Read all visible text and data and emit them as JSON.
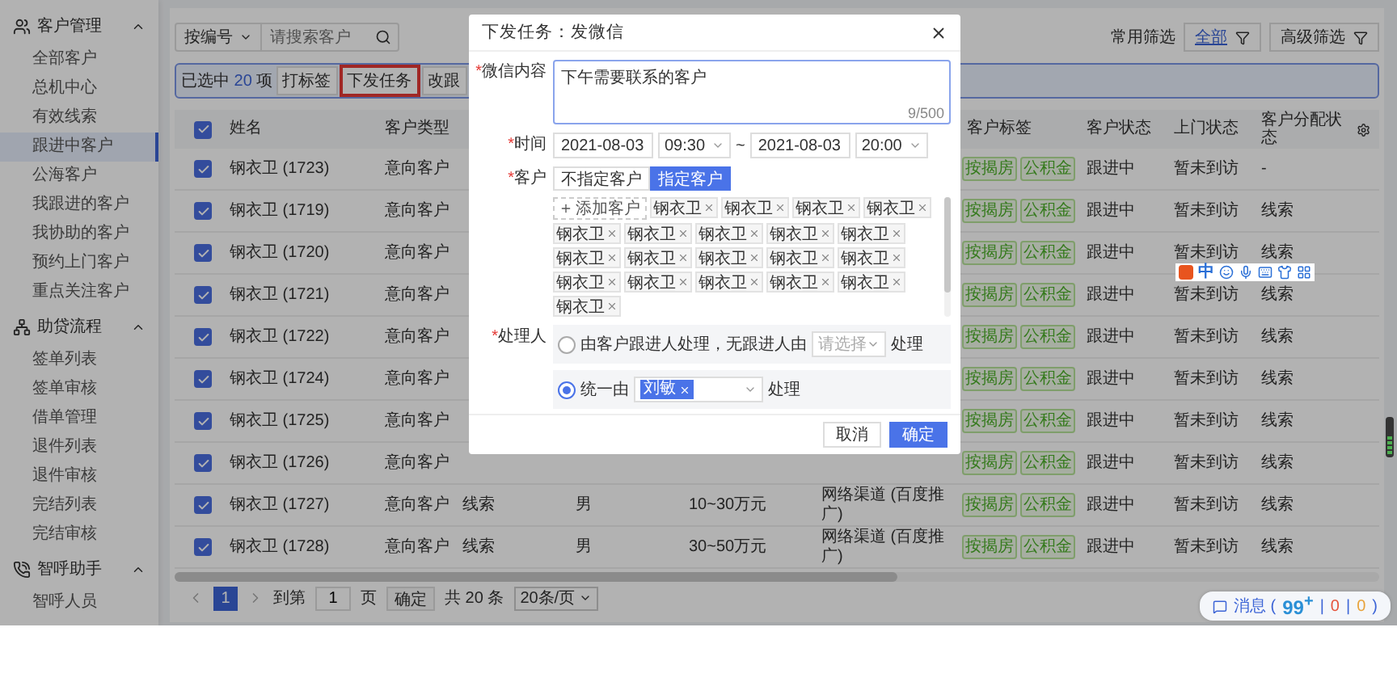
{
  "sidebar": {
    "sections": [
      {
        "title": "客户管理",
        "expanded": true,
        "items": [
          {
            "label": "全部客户",
            "selected": false
          },
          {
            "label": "总机中心",
            "selected": false
          },
          {
            "label": "有效线索",
            "selected": false
          },
          {
            "label": "跟进中客户",
            "selected": true
          },
          {
            "label": "公海客户",
            "selected": false
          },
          {
            "label": "我跟进的客户",
            "selected": false
          },
          {
            "label": "我协助的客户",
            "selected": false
          },
          {
            "label": "预约上门客户",
            "selected": false
          },
          {
            "label": "重点关注客户",
            "selected": false
          }
        ]
      },
      {
        "title": "助贷流程",
        "expanded": true,
        "items": [
          {
            "label": "签单列表",
            "selected": false
          },
          {
            "label": "签单审核",
            "selected": false
          },
          {
            "label": "借单管理",
            "selected": false
          },
          {
            "label": "退件列表",
            "selected": false
          },
          {
            "label": "退件审核",
            "selected": false
          },
          {
            "label": "完结列表",
            "selected": false
          },
          {
            "label": "完结审核",
            "selected": false
          }
        ]
      },
      {
        "title": "智呼助手",
        "expanded": true,
        "items": [
          {
            "label": "智呼人员",
            "selected": false
          }
        ]
      }
    ]
  },
  "toolbar": {
    "search_by": "按编号",
    "search_placeholder": "请搜索客户",
    "filter_label": "常用筛选",
    "filter_value": "全部",
    "advanced_filter": "高级筛选"
  },
  "selection_bar": {
    "prefix": "已选中",
    "count": "20",
    "unit": "项",
    "actions": [
      {
        "label": "打标签",
        "highlighted": false
      },
      {
        "label": "下发任务",
        "highlighted": true
      },
      {
        "label": "改跟",
        "highlighted": false
      }
    ]
  },
  "table": {
    "all_checked": true,
    "headers": [
      "姓名",
      "客户类型",
      "客户标签",
      "客户状态",
      "上门状态",
      "客户分配状态"
    ],
    "rows": [
      {
        "checked": true,
        "name": "钢衣卫 (1723)",
        "type": "意向客户",
        "tags": [
          "按揭房",
          "公积金"
        ],
        "status": "跟进中",
        "visit": "暂未到访",
        "assign": "-"
      },
      {
        "checked": true,
        "name": "钢衣卫 (1719)",
        "type": "意向客户",
        "tags": [
          "按揭房",
          "公积金"
        ],
        "status": "跟进中",
        "visit": "暂未到访",
        "assign": "线索"
      },
      {
        "checked": true,
        "name": "钢衣卫 (1720)",
        "type": "意向客户",
        "tags": [
          "按揭房",
          "公积金"
        ],
        "status": "跟进中",
        "visit": "暂未到访",
        "assign": "线索"
      },
      {
        "checked": true,
        "name": "钢衣卫 (1721)",
        "type": "意向客户",
        "tags": [
          "按揭房",
          "公积金"
        ],
        "status": "跟进中",
        "visit": "暂未到访",
        "assign": "线索"
      },
      {
        "checked": true,
        "name": "钢衣卫 (1722)",
        "type": "意向客户",
        "tags": [
          "按揭房",
          "公积金"
        ],
        "status": "跟进中",
        "visit": "暂未到访",
        "assign": "线索"
      },
      {
        "checked": true,
        "name": "钢衣卫 (1724)",
        "type": "意向客户",
        "tags": [
          "按揭房",
          "公积金"
        ],
        "status": "跟进中",
        "visit": "暂未到访",
        "assign": "线索"
      },
      {
        "checked": true,
        "name": "钢衣卫 (1725)",
        "type": "意向客户",
        "tags": [
          "按揭房",
          "公积金"
        ],
        "status": "跟进中",
        "visit": "暂未到访",
        "assign": "线索"
      },
      {
        "checked": true,
        "name": "钢衣卫 (1726)",
        "type": "意向客户",
        "tags": [
          "按揭房",
          "公积金"
        ],
        "status": "跟进中",
        "visit": "暂未到访",
        "assign": "线索"
      },
      {
        "checked": true,
        "name": "钢衣卫 (1727)",
        "type": "意向客户",
        "source": "线索",
        "gender": "男",
        "budget": "10~30万元",
        "channel": "网络渠道 (百度推广)",
        "tags": [
          "按揭房",
          "公积金"
        ],
        "status": "跟进中",
        "visit": "暂未到访",
        "assign": "线索"
      },
      {
        "checked": true,
        "name": "钢衣卫 (1728)",
        "type": "意向客户",
        "source": "线索",
        "gender": "男",
        "budget": "30~50万元",
        "channel": "网络渠道 (百度推广)",
        "tags": [
          "按揭房",
          "公积金"
        ],
        "status": "跟进中",
        "visit": "暂未到访",
        "assign": "线索"
      }
    ]
  },
  "pagination": {
    "current": "1",
    "goto_label": "到第",
    "goto_value": "1",
    "page_unit": "页",
    "confirm": "确定",
    "total": "共 20 条",
    "page_size": "20条/页"
  },
  "messages": {
    "label": "消息",
    "open": "(",
    "close": ")",
    "separator": "|",
    "counts": [
      {
        "value": "99$^{+}$",
        "color": "#2a8fd6"
      },
      {
        "value": "0",
        "color": "#e5533c"
      },
      {
        "value": "0",
        "color": "#e8a23a"
      }
    ]
  },
  "ime_toolbar": {
    "label": "中"
  },
  "dialog": {
    "title": "下发任务：发微信",
    "content": {
      "mark": "*",
      "label": "微信内容",
      "value": "下午需要联系的客户",
      "counter": "9/500"
    },
    "time": {
      "mark": "*",
      "label": "时间",
      "start_date": "2021-08-03",
      "start_time": "09:30",
      "separator": "~",
      "end_date": "2021-08-03",
      "end_time": "20:00"
    },
    "customer": {
      "mark": "*",
      "label": "客户",
      "modes": [
        {
          "label": "不指定客户",
          "selected": false
        },
        {
          "label": "指定客户",
          "selected": true
        }
      ],
      "add_label": "添加客户",
      "tags": [
        "钢衣卫",
        "钢衣卫",
        "钢衣卫",
        "钢衣卫",
        "钢衣卫",
        "钢衣卫",
        "钢衣卫",
        "钢衣卫",
        "钢衣卫",
        "钢衣卫",
        "钢衣卫",
        "钢衣卫",
        "钢衣卫",
        "钢衣卫",
        "钢衣卫",
        "钢衣卫",
        "钢衣卫",
        "钢衣卫",
        "钢衣卫",
        "钢衣卫"
      ]
    },
    "handler": {
      "mark": "*",
      "label": "处理人",
      "options": [
        {
          "kind": "follower",
          "selected": false,
          "text": "由客户跟进人处理，无跟进人由",
          "placeholder": "请选择",
          "suffix": "处理"
        },
        {
          "kind": "fixed",
          "selected": true,
          "text": "统一由",
          "chosen": [
            "刘敏"
          ],
          "suffix": "处理"
        }
      ]
    },
    "buttons": [
      {
        "label": "取消",
        "primary": false
      },
      {
        "label": "确定",
        "primary": true
      }
    ]
  }
}
